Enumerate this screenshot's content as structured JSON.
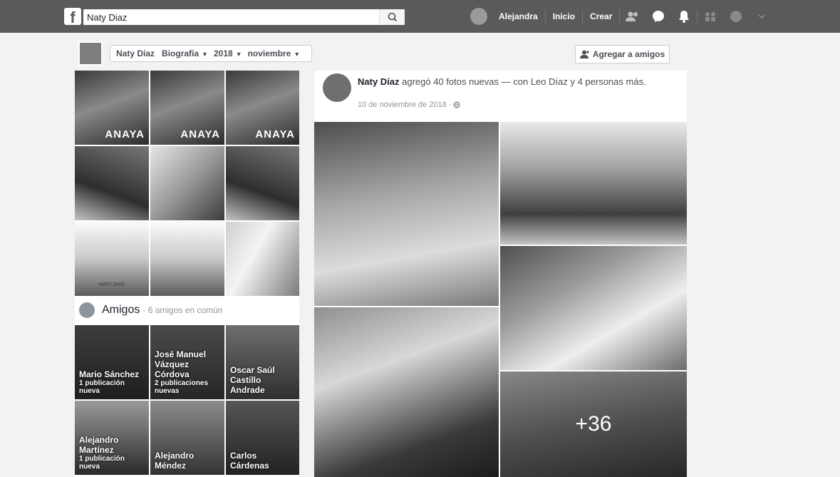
{
  "topbar": {
    "search_value": "Naty Diaz",
    "profile_name": "Alejandra",
    "home_label": "Inicio",
    "create_label": "Crear"
  },
  "profile_bar": {
    "name": "Naty Díaz",
    "crumbs": [
      {
        "label": "Biografía"
      },
      {
        "label": "2018"
      },
      {
        "label": "noviembre"
      }
    ],
    "add_friend_label": "Agregar a amigos"
  },
  "photos": {
    "tile_caption": "ANAYA",
    "tile_logo_text": "NATY DIAZ"
  },
  "amigos": {
    "title": "Amigos",
    "subtitle": "· 6 amigos en común",
    "friends": [
      {
        "name": "Mario Sánchez",
        "sub": "1 publicación nueva"
      },
      {
        "name": "José Manuel Vázquez Córdova",
        "sub": "2 publicaciones nuevas"
      },
      {
        "name": "Oscar Saúl Castillo Andrade",
        "sub": ""
      },
      {
        "name": "Alejandro Martínez",
        "sub": "1 publicación nueva"
      },
      {
        "name": "Alejandro Méndez",
        "sub": ""
      },
      {
        "name": "Carlos Cárdenas",
        "sub": ""
      }
    ]
  },
  "post": {
    "author": "Naty Díaz",
    "action_text": " agregó 40 fotos nuevas — con Leo Díaz y 4 personas más.",
    "time": "10 de noviembre de 2018 ·",
    "more_photos": "+36"
  }
}
